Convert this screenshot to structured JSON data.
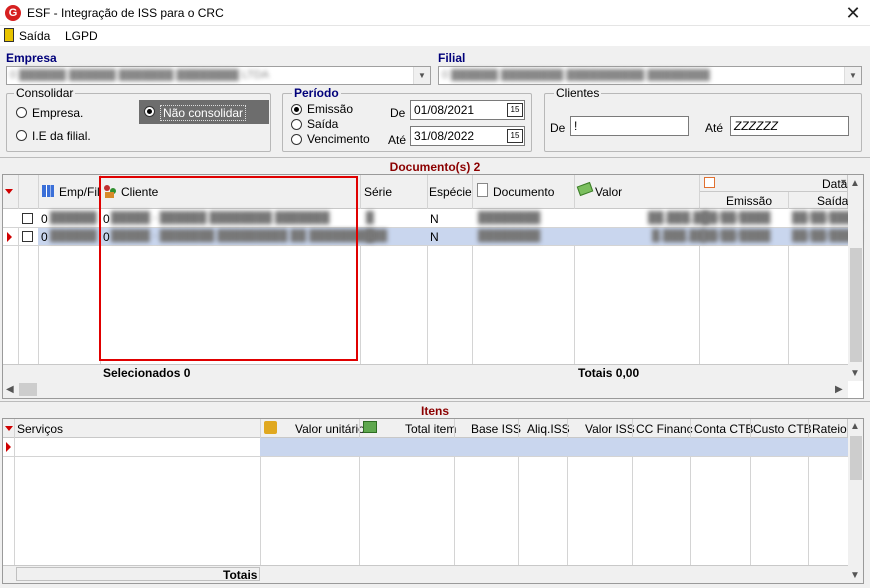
{
  "window": {
    "title": "ESF - Integração de ISS para o CRC",
    "app_icon": "G"
  },
  "menu": {
    "items": [
      {
        "label": "Saída"
      },
      {
        "label": "LGPD"
      }
    ]
  },
  "empresa": {
    "label": "Empresa",
    "value": "0 ██████ ██████ ███████ ████████ LTDA"
  },
  "filial": {
    "label": "Filial",
    "value": "0 ██████ ████████ ██████████ ████████"
  },
  "consolidar": {
    "title": "Consolidar",
    "options": [
      {
        "label": "Empresa."
      },
      {
        "label": "I.E da filial."
      },
      {
        "label": "Não consolidar"
      }
    ]
  },
  "periodo": {
    "title": "Período",
    "options": [
      {
        "label": "Emissão"
      },
      {
        "label": "Saída"
      },
      {
        "label": "Vencimento"
      }
    ],
    "de_label": "De",
    "de_value": "01/08/2021",
    "ate_label": "Até",
    "ate_value": "31/08/2022"
  },
  "clientes": {
    "title": "Clientes",
    "de_label": "De",
    "de_value": "!",
    "ate_label": "Até",
    "ate_value": "ZZZZZZ"
  },
  "documentos": {
    "section_title": "Documento(s) 2",
    "columns": {
      "emp_fil": "Emp/Fil",
      "cliente": "Cliente",
      "serie": "Série",
      "especie": "Espécie",
      "documento": "Documento",
      "valor": "Valor",
      "datas": "Datas",
      "emissao": "Emissão",
      "saida": "Saída"
    },
    "rows": [
      {
        "emp": "0",
        "cli_prefix": "0",
        "cliente": "█████ - ██████ ████████ ███████",
        "serie": "█",
        "especie": "N",
        "documento": "████████",
        "valor": "██.███,██",
        "emissao": "██/██/████",
        "saida": "██/██/████"
      },
      {
        "emp": "0",
        "cli_prefix": "0",
        "cliente": "█████ - ███████ █████████ ██ ██████████",
        "serie": "█",
        "especie": "N",
        "documento": "████████",
        "valor": "█.███,██",
        "emissao": "██/██/████",
        "saida": "██/██/████"
      }
    ],
    "footer": {
      "selecionados": "Selecionados 0",
      "totais": "Totais 0,00"
    }
  },
  "itens": {
    "section_title": "Itens",
    "columns": {
      "servicos": "Serviços",
      "valor_unitario": "Valor unitário",
      "total_item": "Total item",
      "base_iss": "Base ISS",
      "aliq_iss": "Aliq.ISS",
      "valor_iss": "Valor ISS",
      "cc_financ": "CC Financ",
      "conta_ctb": "Conta CTB",
      "custo_ctb": "Custo CTB",
      "rateio": "Rateio"
    },
    "footer": {
      "totais": "Totais"
    }
  },
  "colors": {
    "accent": "#d00000",
    "label_blue": "#00007a",
    "selected_row": "#c9d6ee",
    "highlight_box": "#e00000"
  }
}
